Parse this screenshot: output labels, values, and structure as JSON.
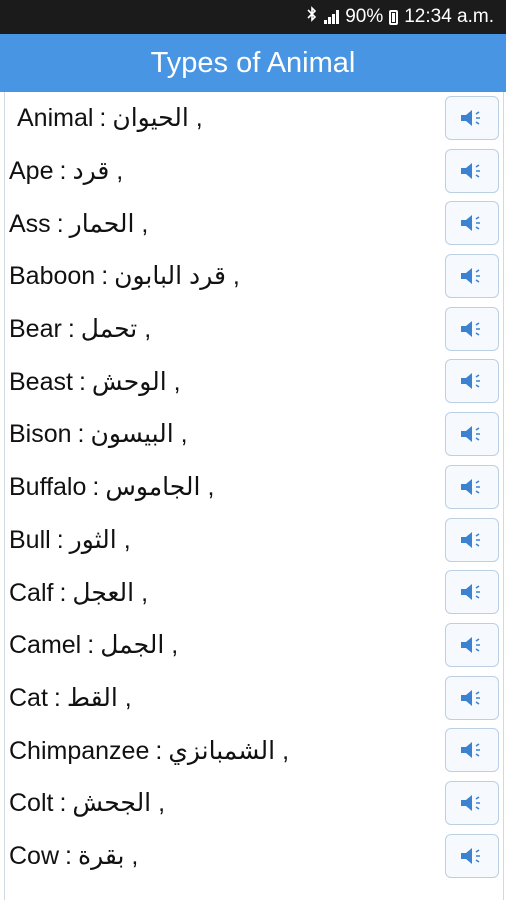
{
  "status": {
    "battery": "90%",
    "time": "12:34 a.m.",
    "icons": [
      "bluetooth-icon",
      "signal-icon",
      "battery-icon"
    ]
  },
  "header": {
    "title": "Types of Animal"
  },
  "colors": {
    "header_bg": "#4895e3",
    "status_bg": "#1b1b1b",
    "speaker_icon": "#3b82d0"
  },
  "list": {
    "items": [
      {
        "en": "Animal",
        "ar": "الحيوان",
        "icon": "speaker-icon"
      },
      {
        "en": "Ape",
        "ar": "قرد",
        "icon": "speaker-icon"
      },
      {
        "en": "Ass",
        "ar": "الحمار",
        "icon": "speaker-icon"
      },
      {
        "en": "Baboon",
        "ar": "قرد البابون",
        "icon": "speaker-icon"
      },
      {
        "en": "Bear",
        "ar": "تحمل",
        "icon": "speaker-icon"
      },
      {
        "en": "Beast",
        "ar": "الوحش",
        "icon": "speaker-icon"
      },
      {
        "en": "Bison",
        "ar": "البيسون",
        "icon": "speaker-icon"
      },
      {
        "en": "Buffalo",
        "ar": "الجاموس",
        "icon": "speaker-icon"
      },
      {
        "en": "Bull",
        "ar": "الثور",
        "icon": "speaker-icon"
      },
      {
        "en": "Calf",
        "ar": "العجل",
        "icon": "speaker-icon"
      },
      {
        "en": "Camel",
        "ar": "الجمل",
        "icon": "speaker-icon"
      },
      {
        "en": "Cat",
        "ar": "القط",
        "icon": "speaker-icon"
      },
      {
        "en": "Chimpanzee",
        "ar": "الشمبانزي",
        "icon": "speaker-icon"
      },
      {
        "en": "Colt",
        "ar": "الجحش",
        "icon": "speaker-icon"
      },
      {
        "en": "Cow",
        "ar": "بقرة",
        "icon": "speaker-icon"
      }
    ]
  }
}
